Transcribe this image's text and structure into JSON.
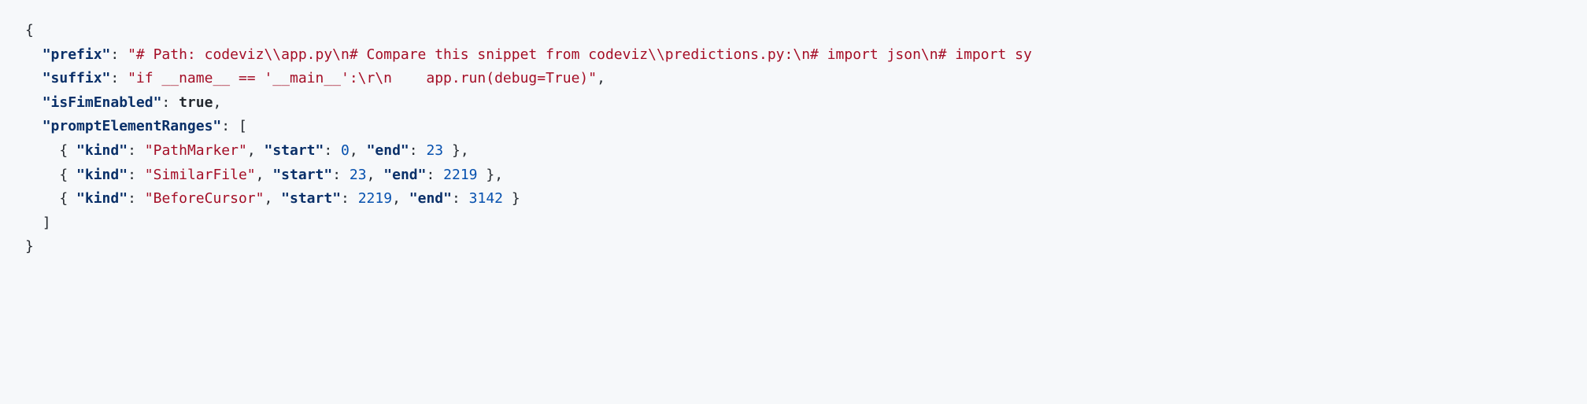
{
  "json_content": {
    "prefix_key": "\"prefix\"",
    "prefix_value": "\"# Path: codeviz\\\\app.py\\n# Compare this snippet from codeviz\\\\predictions.py:\\n# import json\\n# import sy",
    "suffix_key": "\"suffix\"",
    "suffix_value": "\"if __name__ == '__main__':\\r\\n    app.run(debug=True)\"",
    "isFimEnabled_key": "\"isFimEnabled\"",
    "isFimEnabled_value": "true",
    "promptElementRanges_key": "\"promptElementRanges\"",
    "ranges": [
      {
        "kind_key": "\"kind\"",
        "kind_value": "\"PathMarker\"",
        "start_key": "\"start\"",
        "start_value": "0",
        "end_key": "\"end\"",
        "end_value": "23"
      },
      {
        "kind_key": "\"kind\"",
        "kind_value": "\"SimilarFile\"",
        "start_key": "\"start\"",
        "start_value": "23",
        "end_key": "\"end\"",
        "end_value": "2219"
      },
      {
        "kind_key": "\"kind\"",
        "kind_value": "\"BeforeCursor\"",
        "start_key": "\"start\"",
        "start_value": "2219",
        "end_key": "\"end\"",
        "end_value": "3142"
      }
    ]
  },
  "punct": {
    "open_brace": "{",
    "close_brace": "}",
    "open_bracket": "[",
    "close_bracket": "]",
    "colon_space": ": ",
    "comma": ",",
    "comma_space": ", "
  }
}
